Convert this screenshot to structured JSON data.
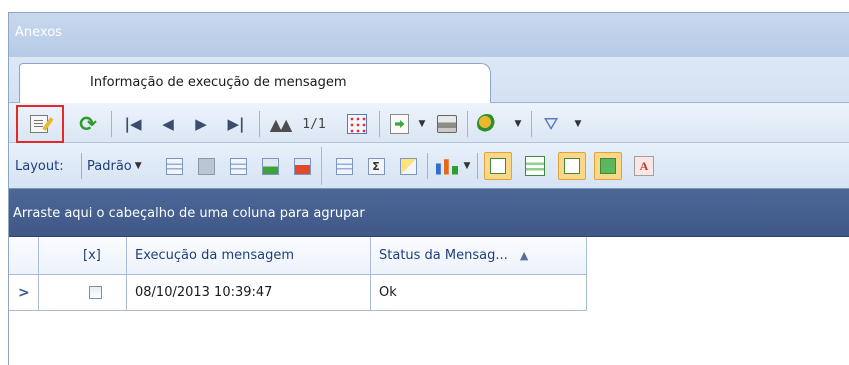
{
  "window": {
    "title": "Anexos"
  },
  "tabs": [
    {
      "label": "Informação de execução de mensagem"
    }
  ],
  "toolbar": {
    "pager": "1/1",
    "icons": [
      "edit-document-icon",
      "refresh-icon",
      "first-record-icon",
      "previous-record-icon",
      "next-record-icon",
      "last-record-icon",
      "find-icon",
      "grid-options-icon",
      "export-icon",
      "print-icon",
      "settings-gears-icon",
      "filter-icon"
    ]
  },
  "layout_bar": {
    "label": "Layout:",
    "selected_layout": "Padrão"
  },
  "grid": {
    "group_panel_text": "Arraste aqui o cabeçalho de uma coluna para agrupar",
    "columns": [
      {
        "label": "[x]"
      },
      {
        "label": "Execução da mensagem"
      },
      {
        "label": "Status da Mensag...",
        "sort": "ascending"
      }
    ],
    "rows": [
      {
        "indicator": ">",
        "checked": false,
        "execucao": "08/10/2013 10:39:47",
        "status": "Ok"
      }
    ]
  },
  "colors": {
    "highlight": "#e22a2a",
    "group_panel_bg": "#4c6797",
    "title_bar_bg": "#c8d8ee"
  }
}
